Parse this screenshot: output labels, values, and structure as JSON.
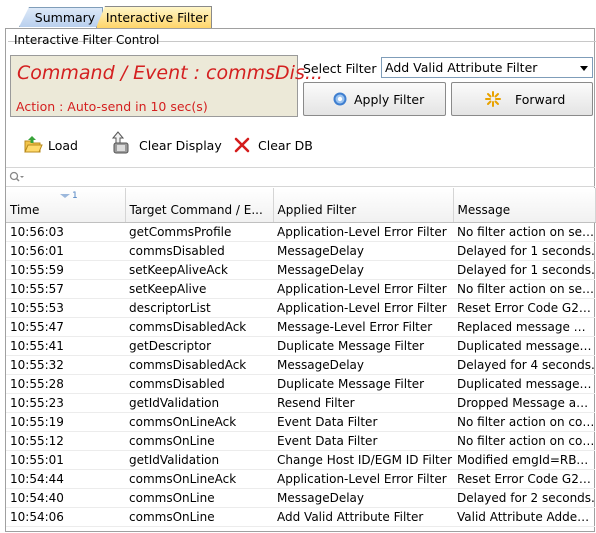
{
  "tabs": [
    {
      "label": "Summary",
      "active": false
    },
    {
      "label": "Interactive Filter",
      "active": true
    }
  ],
  "filter_control": {
    "group_title": "Interactive Filter Control",
    "command_event": "Command / Event : commsDis...",
    "action": "Action : Auto-send in 10 sec(s)",
    "select_label": "Select Filter :",
    "select_value": "Add Valid Attribute Filter",
    "apply_label": "Apply Filter",
    "forward_label": "Forward"
  },
  "toolbar": {
    "load_label": "Load",
    "clear_display_label": "Clear Display",
    "clear_db_label": "Clear DB"
  },
  "table": {
    "sort_indicator": "1",
    "columns": [
      "Time",
      "Target Command / E...",
      "Applied Filter",
      "Message"
    ],
    "rows": [
      [
        "10:56:03",
        "getCommsProfile",
        "Application-Level Error Filter",
        "No filter action on ses..."
      ],
      [
        "10:56:01",
        "commsDisabled",
        "MessageDelay",
        "Delayed for 1 seconds."
      ],
      [
        "10:55:59",
        "setKeepAliveAck",
        "MessageDelay",
        "Delayed for 1 seconds."
      ],
      [
        "10:55:57",
        "setKeepAlive",
        "Application-Level Error Filter",
        "No filter action on ses..."
      ],
      [
        "10:55:53",
        "descriptorList",
        "Application-Level Error Filter",
        "Reset Error Code G2S..."
      ],
      [
        "10:55:47",
        "commsDisabledAck",
        "Message-Level Error Filter",
        "Replaced message wit..."
      ],
      [
        "10:55:41",
        "getDescriptor",
        "Duplicate Message Filter",
        "Duplicated message 1 ..."
      ],
      [
        "10:55:32",
        "commsDisabledAck",
        "MessageDelay",
        "Delayed for 4 seconds."
      ],
      [
        "10:55:28",
        "commsDisabled",
        "Duplicate Message Filter",
        "Duplicated message 1 ..."
      ],
      [
        "10:55:23",
        "getIdValidation",
        "Resend Filter",
        "Dropped Message and..."
      ],
      [
        "10:55:19",
        "commsOnLineAck",
        "Event Data Filter",
        "No filter action on com..."
      ],
      [
        "10:55:12",
        "commsOnLine",
        "Event Data Filter",
        "No filter action on com..."
      ],
      [
        "10:55:01",
        "getIdValidation",
        "Change Host ID/EGM ID Filter",
        "Modified emgId=RBG_..."
      ],
      [
        "10:54:44",
        "commsOnLineAck",
        "Application-Level Error Filter",
        "Reset Error Code G2S..."
      ],
      [
        "10:54:40",
        "commsOnLine",
        "MessageDelay",
        "Delayed for 2 seconds."
      ],
      [
        "10:54:06",
        "commsOnLine",
        "Add Valid Attribute Filter",
        "Valid Attribute Added ..."
      ]
    ]
  },
  "colors": {
    "alert_red": "#d42020",
    "active_tab": "#ffd56a",
    "inactive_tab": "#b9d0ee"
  },
  "icons": [
    "folder-open-icon",
    "clear-display-icon",
    "close-x-icon",
    "gear-icon",
    "sparkle-icon",
    "search-icon"
  ]
}
